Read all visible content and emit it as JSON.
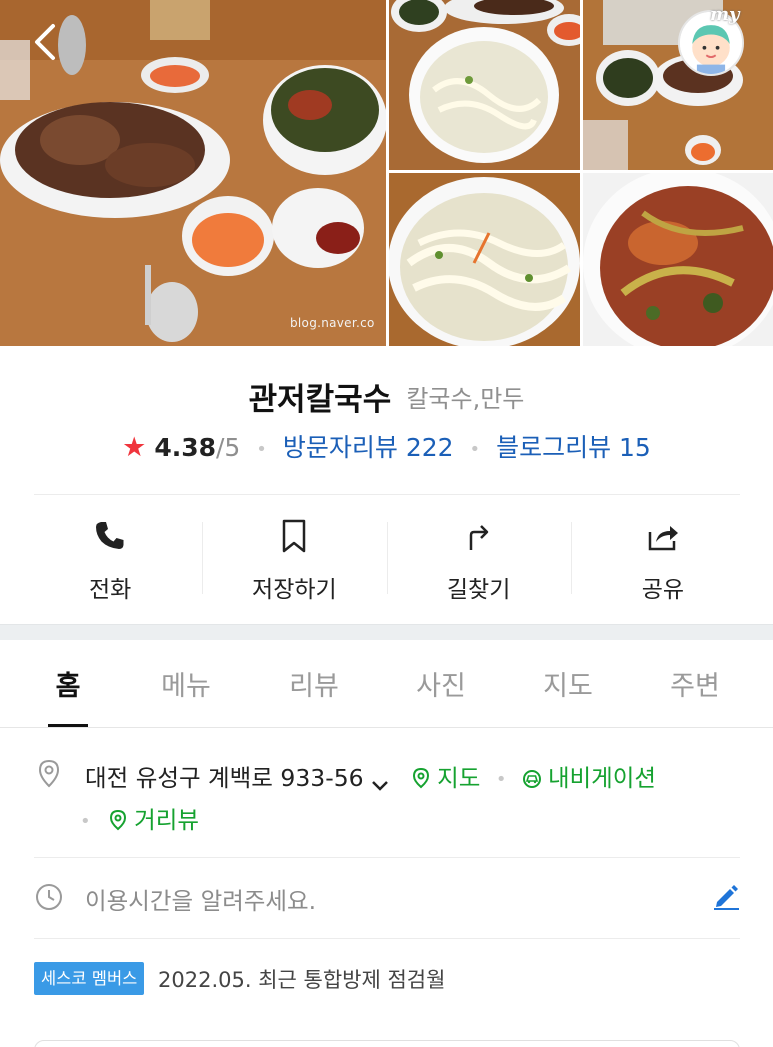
{
  "gallery": {
    "watermark": "blog.naver.co",
    "my_label": "my"
  },
  "place": {
    "name": "관저칼국수",
    "category": "칼국수,만두",
    "rating": "4.38",
    "rating_max": "/5",
    "visitor_reviews": "방문자리뷰 222",
    "blog_reviews": "블로그리뷰 15"
  },
  "actions": [
    {
      "label": "전화",
      "icon": "phone-icon"
    },
    {
      "label": "저장하기",
      "icon": "bookmark-icon"
    },
    {
      "label": "길찾기",
      "icon": "directions-icon"
    },
    {
      "label": "공유",
      "icon": "share-icon"
    }
  ],
  "tabs": [
    {
      "label": "홈",
      "active": true
    },
    {
      "label": "메뉴"
    },
    {
      "label": "리뷰"
    },
    {
      "label": "사진"
    },
    {
      "label": "지도"
    },
    {
      "label": "주변"
    }
  ],
  "info": {
    "address": "대전 유성구 계백로 933-56",
    "map_link": "지도",
    "navigation_link": "내비게이션",
    "streetview_link": "거리뷰",
    "hours_prompt": "이용시간을 알려주세요.",
    "badge": "세스코 멤버스",
    "badge_text": "2022.05. 최근 통합방제 점검월"
  },
  "colors": {
    "star": "#f0353d",
    "review_link": "#1b5fb7",
    "green_link": "#16a230",
    "badge": "#3a9ae6"
  }
}
